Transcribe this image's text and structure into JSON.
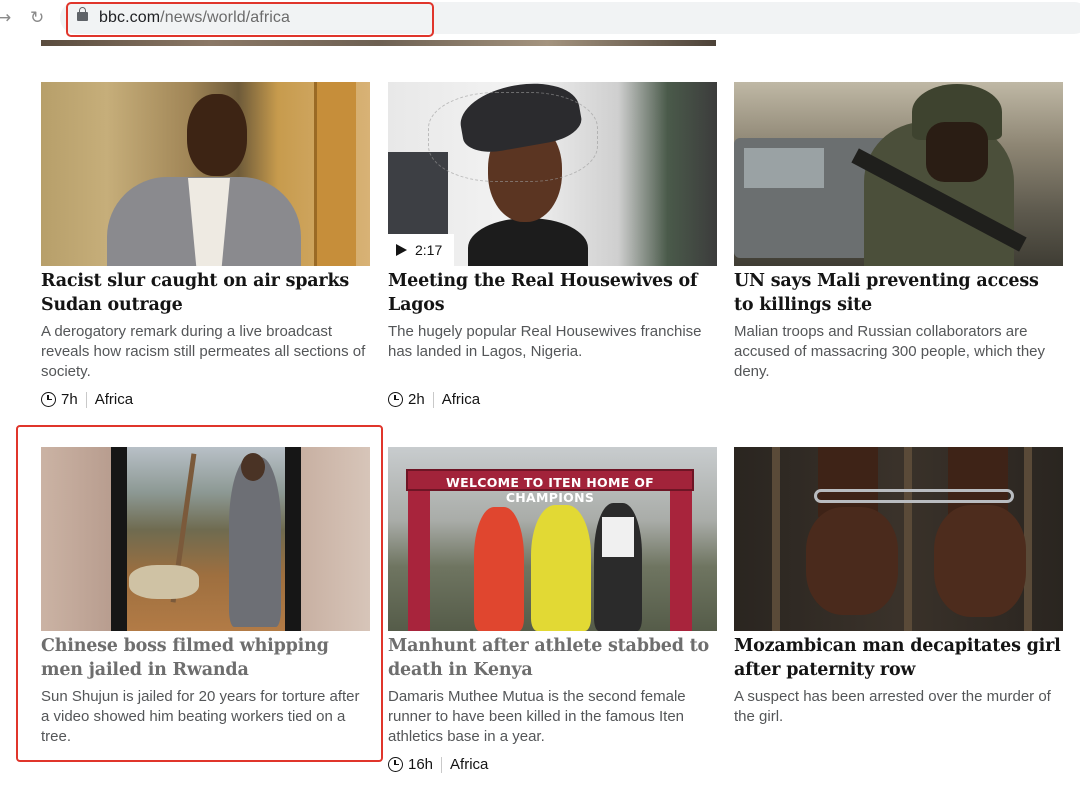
{
  "browser": {
    "url_domain": "bbc.com",
    "url_path": "/news/world/africa"
  },
  "cards": [
    {
      "headline": "Racist slur caught on air sparks Sudan outrage",
      "summary": "A derogatory remark during a live broadcast reveals how racism still permeates all sections of society.",
      "time": "7h",
      "tag": "Africa"
    },
    {
      "headline": "Meeting the Real Housewives of Lagos",
      "summary": "The hugely popular Real Housewives franchise has landed in Lagos, Nigeria.",
      "time": "2h",
      "tag": "Africa",
      "video_duration": "2:17"
    },
    {
      "headline": "UN says Mali preventing access to killings site",
      "summary": "Malian troops and Russian collaborators are accused of massacring 300 people, which they deny."
    },
    {
      "headline": "Chinese boss filmed whipping men jailed in Rwanda",
      "summary": "Sun Shujun is jailed for 20 years for torture after a video showed him beating workers tied on a tree.",
      "visited": true
    },
    {
      "headline": "Manhunt after athlete stabbed to death in Kenya",
      "summary": "Damaris Muthee Mutua is the second female runner to have been killed in the famous Iten athletics base in a year.",
      "time": "16h",
      "tag": "Africa",
      "image_text": "WELCOME TO ITEN HOME OF CHAMPIONS",
      "visited": true
    },
    {
      "headline": "Mozambican man decapitates girl after paternity row",
      "summary": "A suspect has been arrested over the murder of the girl."
    }
  ],
  "colors": {
    "highlight": "#e0352b",
    "headline": "#141414",
    "visited_headline": "#6e6e6e",
    "summary": "#545658"
  }
}
